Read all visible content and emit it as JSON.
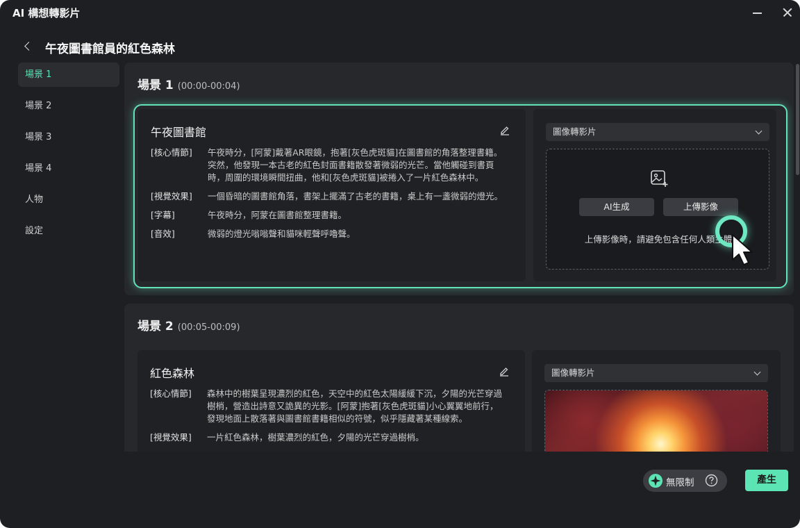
{
  "window": {
    "title": "AI 構想轉影片"
  },
  "header": {
    "title": "午夜圖書館員的紅色森林"
  },
  "sidebar": {
    "items": [
      {
        "label": "場景 1"
      },
      {
        "label": "場景 2"
      },
      {
        "label": "場景 3"
      },
      {
        "label": "場景 4"
      },
      {
        "label": "人物"
      },
      {
        "label": "設定"
      }
    ]
  },
  "scenes": [
    {
      "name": "場景 1",
      "time": "(00:00-00:04)",
      "title": "午夜圖書館",
      "fields": [
        {
          "tag": "[核心情節]",
          "text": "午夜時分，[阿蒙]戴著AR眼鏡，抱著[灰色虎斑貓]在圖書館的角落整理書籍。突然，他發現一本古老的紅色封面書籍散發著微弱的光芒。當他觸碰到書頁時，周圍的環境瞬間扭曲，他和[灰色虎斑貓]被捲入了一片紅色森林中。"
        },
        {
          "tag": "[視覺效果]",
          "text": "一個昏暗的圖書館角落，書架上擺滿了古老的書籍，桌上有一盞微弱的燈光。"
        },
        {
          "tag": "[字幕]",
          "text": "午夜時分，阿蒙在圖書館整理書籍。"
        },
        {
          "tag": "[音效]",
          "text": "微弱的燈光嗡嗡聲和貓咪輕聲呼嚕聲。"
        }
      ],
      "mode": "圖像轉影片",
      "ai_button": "AI生成",
      "upload_button": "上傳影像",
      "upload_note": "上傳影像時，請避免包含任何人類主體"
    },
    {
      "name": "場景 2",
      "time": "(00:05-00:09)",
      "title": "紅色森林",
      "fields": [
        {
          "tag": "[核心情節]",
          "text": "森林中的樹葉呈現濃烈的紅色，天空中的紅色太陽緩緩下沉，夕陽的光芒穿過樹梢，營造出詩意又詭異的光影。[阿蒙]抱著[灰色虎斑貓]小心翼翼地前行，發現地面上散落著與圖書館書籍相似的符號，似乎隱藏著某種線索。"
        },
        {
          "tag": "[視覺效果]",
          "text": "一片紅色森林，樹葉濃烈的紅色，夕陽的光芒穿過樹梢。"
        }
      ],
      "mode": "圖像轉影片"
    }
  ],
  "footer": {
    "credits_label": "無限制",
    "generate_label": "產生"
  },
  "colors": {
    "accent": "#5ce4b4",
    "background": "#1d1f22",
    "panel": "#26282c"
  },
  "icons": [
    "close-icon",
    "minimize-icon",
    "back-arrow-icon",
    "edit-icon",
    "chevron-down-icon",
    "image-plus-icon",
    "cursor-icon",
    "sparkle-icon",
    "help-icon"
  ]
}
